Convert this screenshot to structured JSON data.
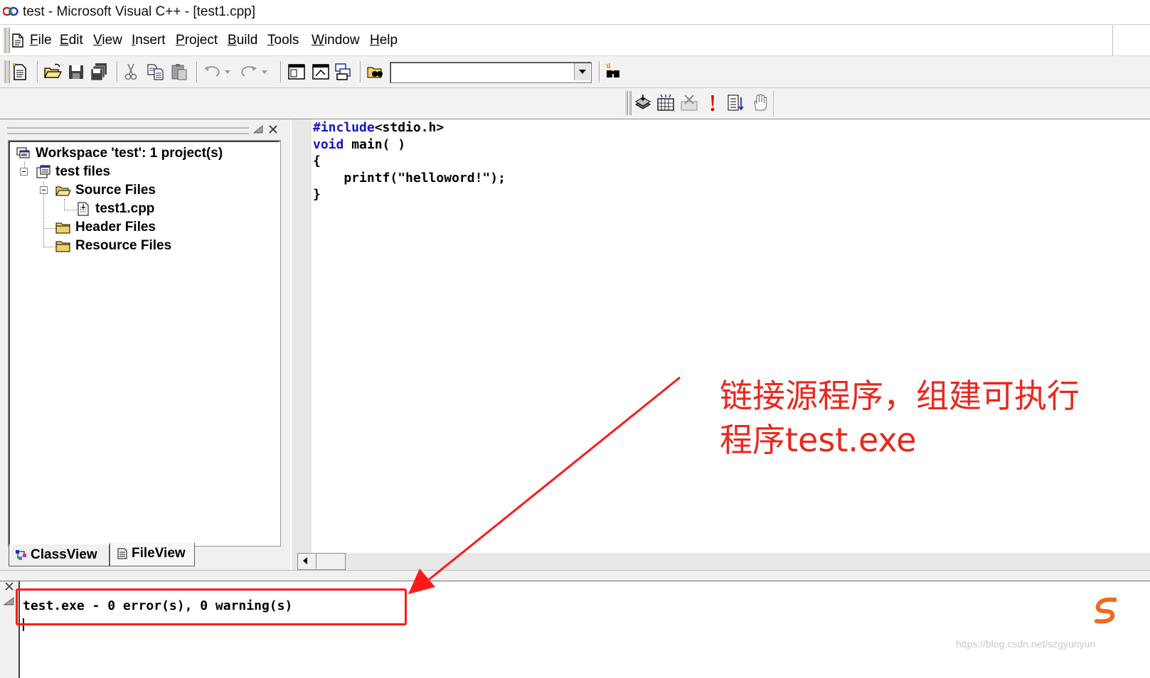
{
  "window": {
    "title": "test - Microsoft Visual C++ - [test1.cpp]"
  },
  "menu": {
    "items": [
      {
        "label": "File",
        "u": "F",
        "rest": "ile"
      },
      {
        "label": "Edit",
        "u": "E",
        "rest": "dit"
      },
      {
        "label": "View",
        "u": "V",
        "rest": "iew"
      },
      {
        "label": "Insert",
        "u": "I",
        "rest": "nsert"
      },
      {
        "label": "Project",
        "u": "P",
        "rest": "roject"
      },
      {
        "label": "Build",
        "u": "B",
        "rest": "uild"
      },
      {
        "label": "Tools",
        "u": "T",
        "rest": "ools"
      },
      {
        "label": "Window",
        "u": "W",
        "rest": "indow"
      },
      {
        "label": "Help",
        "u": "H",
        "rest": "elp"
      }
    ]
  },
  "toolbar": {
    "find_value": "",
    "icons": [
      "new-text-file-icon",
      "open-folder-icon",
      "save-icon",
      "save-all-icon",
      "cut-icon",
      "copy-icon",
      "paste-icon",
      "undo-icon",
      "redo-icon",
      "workspace-icon",
      "output-icon",
      "window-list-icon",
      "find-in-files-icon",
      "find-icon"
    ],
    "build_icons": [
      "compile-icon",
      "build-icon",
      "stop-build-icon",
      "execute-icon",
      "go-icon",
      "breakpoint-icon"
    ]
  },
  "workspace": {
    "tree": {
      "root": "Workspace 'test': 1 project(s)",
      "project": "test files",
      "source_folder": "Source Files",
      "source_file": "test1.cpp",
      "header_folder": "Header Files",
      "resource_folder": "Resource Files"
    },
    "tabs": {
      "classview": "ClassView",
      "fileview": "FileView"
    }
  },
  "editor": {
    "lines": {
      "l1_kw": "#include",
      "l1_rest": "<stdio.h>",
      "l2_kw": "void",
      "l2_rest": " main( )",
      "l3": "{",
      "l4": "    printf(\"helloword!\");",
      "l5": "}"
    }
  },
  "output": {
    "text": "test.exe - 0 error(s), 0 warning(s)"
  },
  "annotation": {
    "line1": "链接源程序，组建可执行",
    "line2": "程序test.exe",
    "color": "#e8281e"
  },
  "watermark": "https://blog.csdn.net/szgyunyun"
}
